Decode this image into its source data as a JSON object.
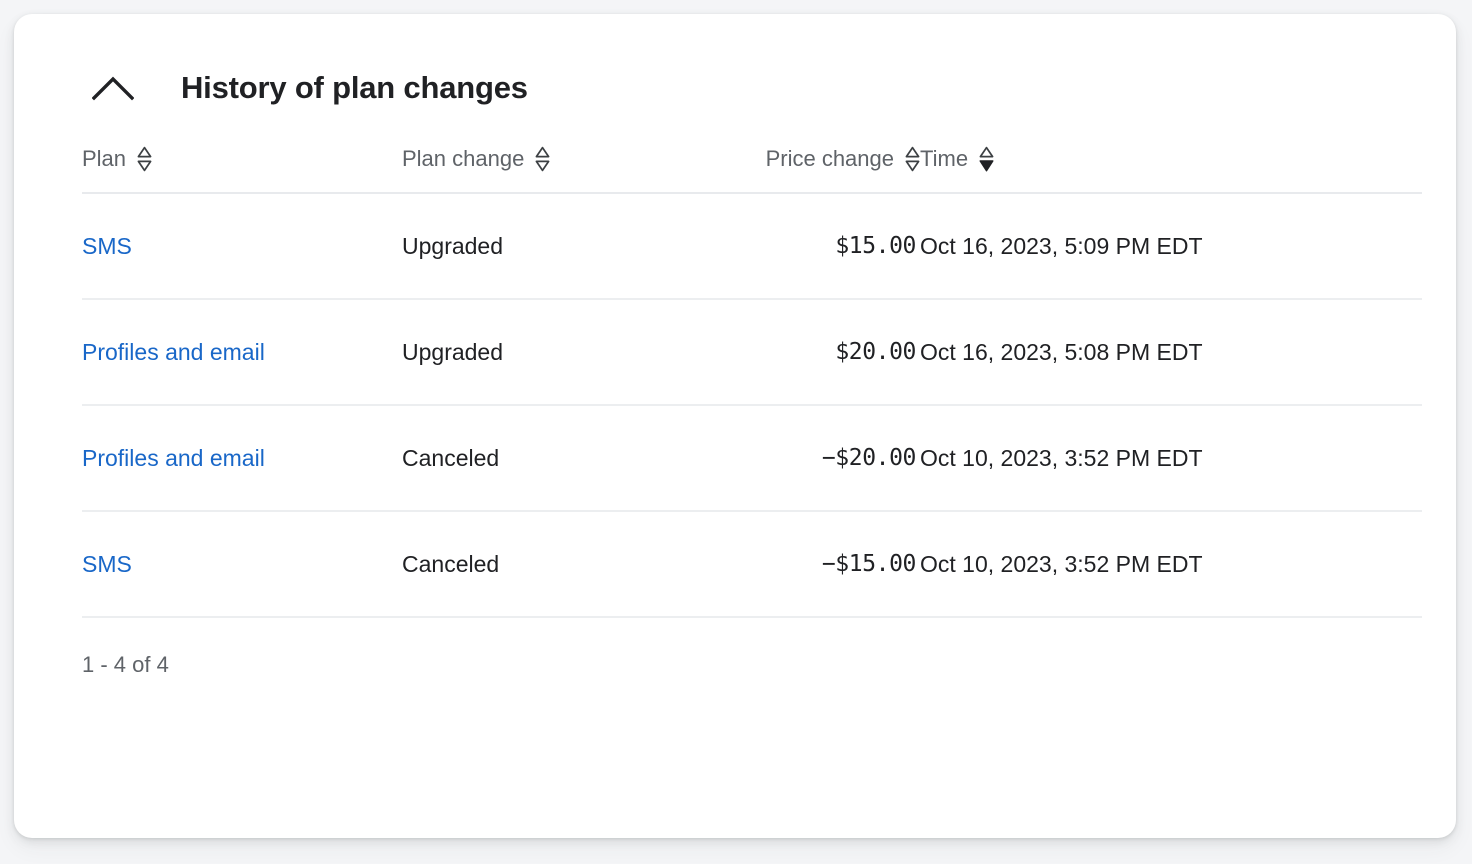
{
  "card": {
    "title": "History of plan changes",
    "collapse_icon": "chevron-up-icon",
    "collapsed": false
  },
  "table": {
    "columns": [
      {
        "key": "plan",
        "label": "Plan",
        "align": "left",
        "sort_icon": "sort-none-icon",
        "sorted": "none"
      },
      {
        "key": "plan_change",
        "label": "Plan change",
        "align": "left",
        "sort_icon": "sort-none-icon",
        "sorted": "none"
      },
      {
        "key": "price_change",
        "label": "Price change",
        "align": "right",
        "sort_icon": "sort-none-icon",
        "sorted": "none"
      },
      {
        "key": "time",
        "label": "Time",
        "align": "left",
        "sort_icon": "sort-desc-icon",
        "sorted": "desc"
      }
    ],
    "rows": [
      {
        "plan": "SMS",
        "plan_change": "Upgraded",
        "price_change": "$15.00",
        "time": "Oct 16, 2023, 5:09 PM EDT"
      },
      {
        "plan": "Profiles and email",
        "plan_change": "Upgraded",
        "price_change": "$20.00",
        "time": "Oct 16, 2023, 5:08 PM EDT"
      },
      {
        "plan": "Profiles and email",
        "plan_change": "Canceled",
        "price_change": "−$20.00",
        "time": "Oct 10, 2023, 3:52 PM EDT"
      },
      {
        "plan": "SMS",
        "plan_change": "Canceled",
        "price_change": "−$15.00",
        "time": "Oct 10, 2023, 3:52 PM EDT"
      }
    ]
  },
  "pagination": {
    "summary": "1 - 4 of 4"
  },
  "colors": {
    "page_background": "#f4f5f7",
    "card_background": "#ffffff",
    "link": "#1967c8",
    "text_primary": "#202124",
    "text_secondary": "#5f6368",
    "divider": "#eceef0"
  }
}
